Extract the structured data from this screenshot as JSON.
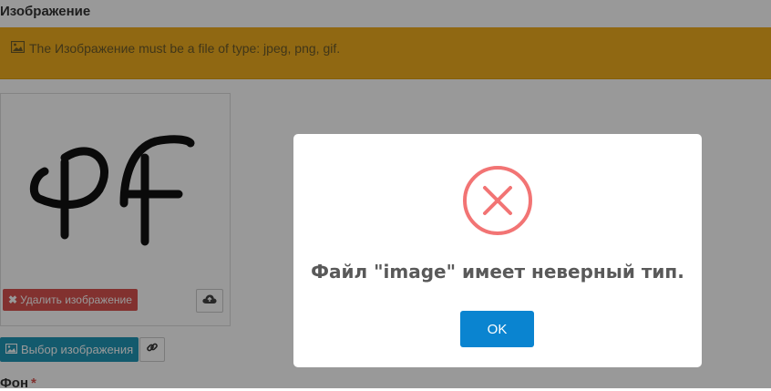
{
  "field": {
    "label": "Изображение"
  },
  "alert": {
    "message": "The Изображение must be a file of type: jpeg, png, gif."
  },
  "preview": {
    "delete_button": "Удалить изображение",
    "select_button": "Выбор изображения"
  },
  "next_field": {
    "label": "Фон",
    "required_mark": "*"
  },
  "modal": {
    "message": "Файл \"image\" имеет неверный тип.",
    "ok_label": "OK"
  },
  "colors": {
    "alert_bg": "#f0ad1f",
    "danger": "#d9534f",
    "primary_btn": "#0a84d0",
    "info_btn": "#2196b6",
    "error_icon": "#f27474"
  },
  "icons": [
    "image-icon",
    "close-icon",
    "cloud-upload-icon",
    "link-icon",
    "error-x-icon"
  ]
}
